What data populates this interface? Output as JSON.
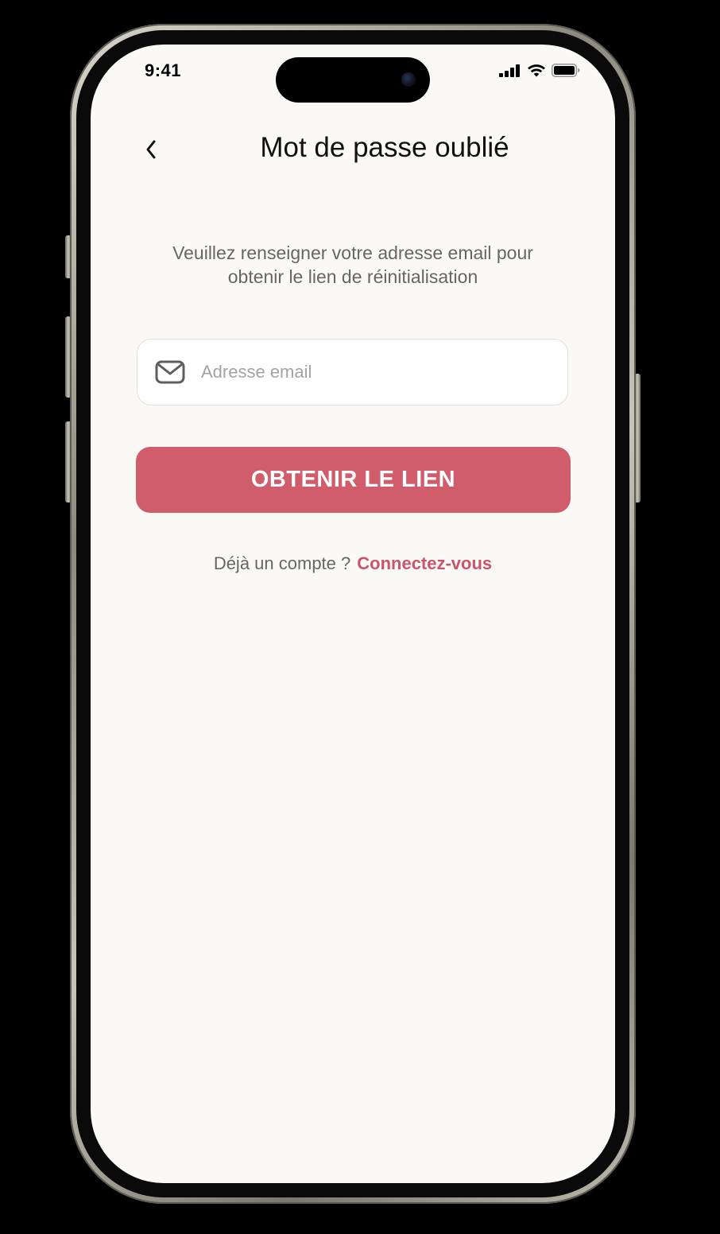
{
  "status_bar": {
    "time": "9:41"
  },
  "header": {
    "back_icon": "chevron-left-icon",
    "title": "Mot de passe oublié"
  },
  "instructions": {
    "line1": "Veuillez renseigner votre adresse email pour",
    "line2": "obtenir le lien de réinitialisation"
  },
  "email_field": {
    "icon": "mail-icon",
    "placeholder": "Adresse email",
    "value": ""
  },
  "primary_button": {
    "label": "OBTENIR LE LIEN"
  },
  "login_prompt": {
    "text": "Déjà un compte ?",
    "link_label": "Connectez-vous"
  },
  "colors": {
    "accent": "#d15c6b",
    "link": "#c9556a",
    "background": "#faf9f6",
    "text_muted": "#666666"
  }
}
